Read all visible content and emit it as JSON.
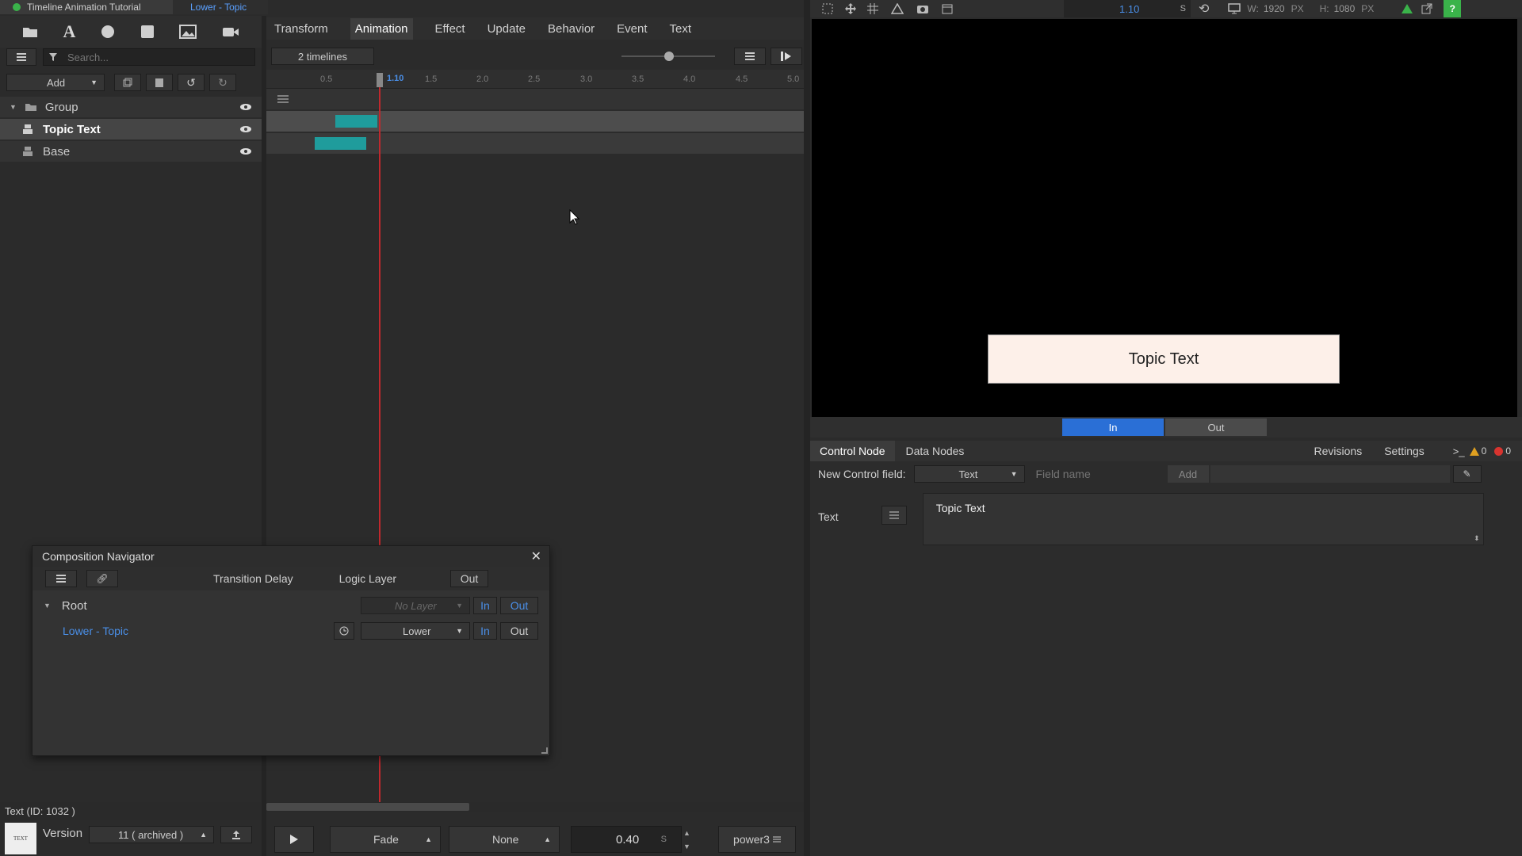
{
  "breadcrumb": {
    "project": "Timeline Animation Tutorial",
    "scene": "Lower - Topic"
  },
  "toolbar": {
    "tools": [
      "folder-icon",
      "text-icon",
      "circle-icon",
      "square-icon",
      "image-icon",
      "video-icon"
    ]
  },
  "search": {
    "placeholder": "Search..."
  },
  "layer_panel": {
    "add_label": "Add",
    "layers": [
      {
        "name": "Group",
        "type": "group"
      },
      {
        "name": "Topic Text",
        "type": "text",
        "selected": true
      },
      {
        "name": "Base",
        "type": "shape"
      }
    ]
  },
  "tabs": [
    "Transform",
    "Animation",
    "Effect",
    "Update",
    "Behavior",
    "Event",
    "Text"
  ],
  "active_tab": "Animation",
  "timeline": {
    "timelines_label": "2 timelines",
    "current_time": "1.10",
    "ticks": [
      "0.5",
      "1.5",
      "2.0",
      "2.5",
      "3.0",
      "3.5",
      "4.0",
      "4.5",
      "5.0"
    ],
    "tracks": [
      {
        "start": 0.65,
        "end": 1.05
      },
      {
        "start": 0.45,
        "end": 0.95
      }
    ]
  },
  "navigator": {
    "title": "Composition Navigator",
    "col_transition": "Transition Delay",
    "col_logic": "Logic Layer",
    "col_out": "Out",
    "rows": [
      {
        "name": "Root",
        "layer": "No Layer",
        "in": "In",
        "out": "Out"
      },
      {
        "name": "Lower - Topic",
        "layer": "Lower",
        "in": "In",
        "out": "Out"
      }
    ]
  },
  "status": {
    "selection": "Text (ID: 1032 )",
    "version_label": "Version",
    "version_value": "11 ( archived )",
    "thumb_label": "TEXT"
  },
  "playback": {
    "in_effect": "Fade",
    "out_effect": "None",
    "duration": "0.40",
    "unit": "S",
    "easing": "power3"
  },
  "preview": {
    "time": "1.10",
    "time_unit": "S",
    "w_label": "W:",
    "w_value": "1920",
    "h_label": "H:",
    "h_value": "1080",
    "unit": "PX",
    "canvas_text": "Topic Text",
    "in_label": "In",
    "out_label": "Out"
  },
  "control": {
    "tabs": [
      "Control Node",
      "Data Nodes"
    ],
    "right_links": [
      "Revisions",
      "Settings"
    ],
    "warn_count": "0",
    "error_count": "0",
    "new_field_label": "New Control field:",
    "field_type": "Text",
    "field_name_placeholder": "Field name",
    "add_label": "Add",
    "text_field_label": "Text",
    "text_value": "Topic Text"
  },
  "colors": {
    "accent": "#2a6fd6",
    "track": "#1f9c9c",
    "playhead": "#c0282d",
    "link": "#4a8fe8"
  }
}
